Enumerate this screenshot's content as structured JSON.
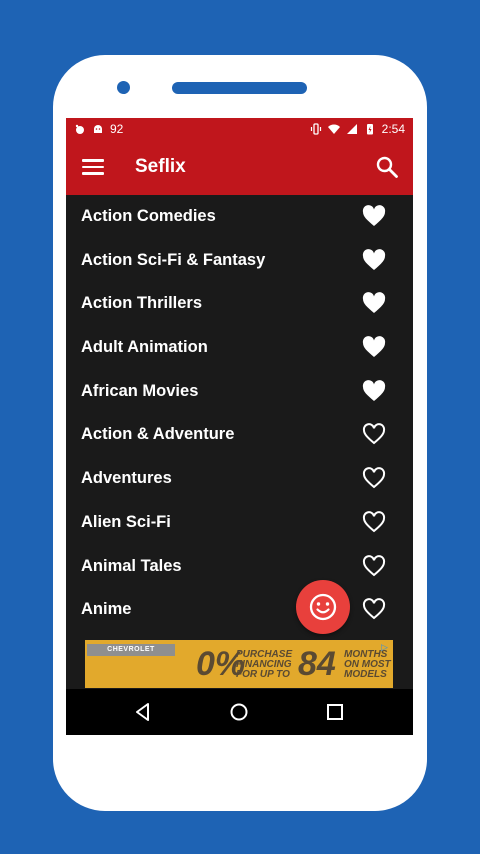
{
  "status_bar": {
    "battery_percent_label": "92",
    "time": "2:54"
  },
  "app_bar": {
    "title": "Seflix"
  },
  "categories": [
    {
      "label": "Action Comedies",
      "favorite": true
    },
    {
      "label": "Action Sci-Fi & Fantasy",
      "favorite": true
    },
    {
      "label": "Action Thrillers",
      "favorite": true
    },
    {
      "label": "Adult Animation",
      "favorite": true
    },
    {
      "label": "African Movies",
      "favorite": true
    },
    {
      "label": "Action & Adventure",
      "favorite": false
    },
    {
      "label": "Adventures",
      "favorite": false
    },
    {
      "label": "Alien Sci-Fi",
      "favorite": false
    },
    {
      "label": "Animal Tales",
      "favorite": false
    },
    {
      "label": "Anime",
      "favorite": false
    }
  ],
  "ad_banner": {
    "brand": "CHEVROLET",
    "rate": "0%",
    "line1": "PURCHASE",
    "line2": "FINANCING",
    "line3": "FOR UP TO",
    "months_number": "84",
    "months_line1": "MONTHS",
    "months_line2": "ON MOST",
    "months_line3": "MODELS"
  },
  "colors": {
    "app_bar": "#c0161c",
    "background": "#1e63b4",
    "list_background": "#1a1a1a",
    "fab": "#e8403c",
    "ad_background": "#e2a92c"
  },
  "icons": {
    "menu": "hamburger-menu-icon",
    "search": "search-icon",
    "favorite_filled": "heart-filled-icon",
    "favorite_outline": "heart-outline-icon",
    "fab": "smiley-face-icon",
    "nav_back": "back-triangle-icon",
    "nav_home": "home-circle-icon",
    "nav_recents": "recents-square-icon"
  }
}
